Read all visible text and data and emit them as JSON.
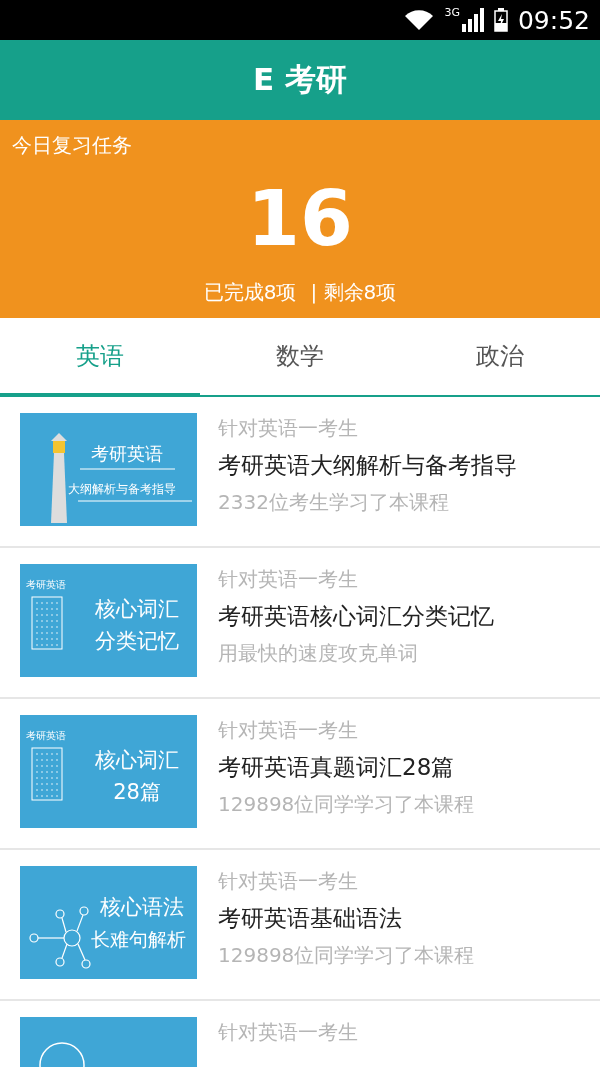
{
  "status_bar": {
    "network": "3G",
    "time": "09:52"
  },
  "header": {
    "title": "E 考研"
  },
  "review": {
    "label": "今日复习任务",
    "total": "16",
    "done": "已完成8项",
    "remaining": "| 剩余8项"
  },
  "tabs": [
    {
      "label": "英语",
      "selected": true
    },
    {
      "label": "数学",
      "selected": false
    },
    {
      "label": "政治",
      "selected": false
    }
  ],
  "courses": [
    {
      "cover": {
        "kind": "lighthouse",
        "lines": [
          "考研英语",
          "大纲解析与备考指导"
        ]
      },
      "audience": "针对英语一考生",
      "title": "考研英语大纲解析与备考指导",
      "note": "2332位考生学习了本课程"
    },
    {
      "cover": {
        "kind": "wordlist",
        "tag": "考研英语",
        "lines": [
          "核心词汇",
          "分类记忆"
        ]
      },
      "audience": "针对英语一考生",
      "title": "考研英语核心词汇分类记忆",
      "note": "用最快的速度攻克单词"
    },
    {
      "cover": {
        "kind": "wordlist",
        "tag": "考研英语",
        "lines": [
          "核心词汇",
          "28篇"
        ]
      },
      "audience": "针对英语一考生",
      "title": "考研英语真题词汇28篇",
      "note": "129898位同学学习了本课程"
    },
    {
      "cover": {
        "kind": "network",
        "lines": [
          "核心语法",
          "长难句解析"
        ]
      },
      "audience": "针对英语一考生",
      "title": "考研英语基础语法",
      "note": "129898位同学学习了本课程"
    },
    {
      "cover": {
        "kind": "ring"
      },
      "audience": "针对英语一考生"
    }
  ]
}
